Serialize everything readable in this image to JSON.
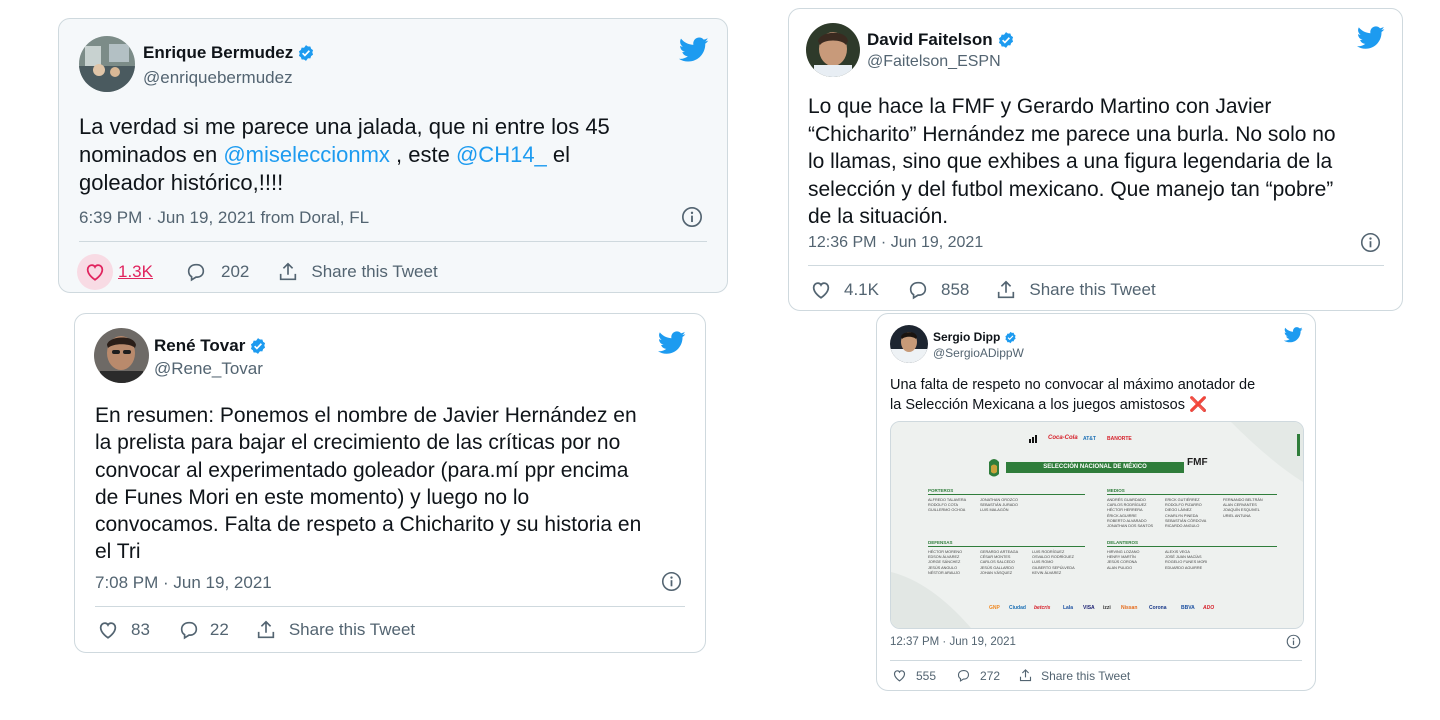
{
  "tweets": [
    {
      "name": "Enrique Bermudez",
      "handle": "@enriquebermudez",
      "body": [
        {
          "text": "La verdad si me parece una jalada, que ni entre los 45\nnominados en "
        },
        {
          "text": "@miseleccionmx",
          "mention": true
        },
        {
          "text": " , este "
        },
        {
          "text": "@CH14_",
          "mention": true
        },
        {
          "text": " el\ngoleador histórico,!!!!"
        }
      ],
      "time": "6:39 PM · Jun 19, 2021 from Doral, FL",
      "likes": "1.3K",
      "replies": "202",
      "share": "Share this Tweet"
    },
    {
      "name": "David Faitelson",
      "handle": "@Faitelson_ESPN",
      "body": [
        {
          "text": "Lo que hace la FMF y Gerardo Martino con Javier\n“Chicharito” Hernández me parece una burla. No solo no\nlo llamas, sino que exhibes a una figura legendaria de la\nselección y del futbol mexicano. Que manejo tan “pobre”\nde la situación."
        }
      ],
      "time": "12:36 PM · Jun 19, 2021",
      "likes": "4.1K",
      "replies": "858",
      "share": "Share this Tweet"
    },
    {
      "name": "René Tovar",
      "handle": "@Rene_Tovar",
      "body": [
        {
          "text": "En resumen: Ponemos el nombre de Javier Hernández en\nla prelista para bajar el crecimiento de las críticas por no\nconvocar al experimentado goleador (para.mí ppr encima\nde Funes Mori en este momento) y luego no lo\nconvocamos. Falta de respeto a Chicharito y su historia en\nel Tri"
        }
      ],
      "time": "7:08 PM · Jun 19, 2021",
      "likes": "83",
      "replies": "22",
      "share": "Share this Tweet"
    },
    {
      "name": "Sergio Dipp",
      "handle": "@SergioADippW",
      "body": [
        {
          "text": "Una falta de respeto no convocar al máximo anotador de\nla Selección Mexicana a los juegos amistosos ❌"
        }
      ],
      "time": "12:37 PM · Jun 19, 2021",
      "likes": "555",
      "replies": "272",
      "share": "Share this Tweet",
      "media": {
        "title": "SELECCIÓN NACIONAL DE MÉXICO",
        "logo": "FMF",
        "sections": {
          "porteros": {
            "label": "PORTEROS",
            "players": [
              "ALFREDO TALAVERA",
              "RODOLFO COTA",
              "GUILLERMO OCHOA",
              "JONATHAN OROZCO",
              "SEBASTIÁN JURADO",
              "LUIS MALAGÓN"
            ]
          },
          "medios": {
            "label": "MEDIOS",
            "players": [
              "ANDRÉS GUARDADO",
              "CARLOS RODRÍGUEZ",
              "HÉCTOR HERRERA",
              "ÉRICK AGUIRRE",
              "ROBERTO ALVARADO",
              "JONATHAN DOS SANTOS",
              "ERICK GUTIÉRREZ",
              "RODOLFO PIZARRO",
              "DIEGO LÁINEZ",
              "CHARLYN PINEDA",
              "SEBASTIÁN CÓRDOVA",
              "RICARDO ANGULO",
              "FERNANDO BELTRÁN",
              "ALAN CERVANTES",
              "JOAQUÍN ESQUIVEL",
              "URIEL ANTUNA"
            ]
          },
          "defensas": {
            "label": "DEFENSAS",
            "players": [
              "HÉCTOR MORENO",
              "EDSON ÁLVAREZ",
              "JORGE SÁNCHEZ",
              "JESÚS ANGULO",
              "NÉSTOR ARAUJO",
              "GERARDO ARTEAGA",
              "CÉSAR MONTES",
              "CARLOS SALCEDO",
              "JESÚS GALLARDO",
              "JOHAN VÁSQUEZ",
              "LUIS RODRÍGUEZ",
              "OSVALDO RODRÍGUEZ",
              "LUIS ROMO",
              "GILBERTO SEPÚLVEDA",
              "KEVIN ÁLVAREZ"
            ]
          },
          "delanteros": {
            "label": "DELANTEROS",
            "players": [
              "HIRVING LOZANO",
              "HENRY MARTÍN",
              "JESÚS CORONA",
              "ALAN PULIDO",
              "ALEXIS VEGA",
              "JOSÉ JUAN MACÍAS",
              "ROGELIO FUNES MORI",
              "EDUARDO AGUIRRE"
            ]
          }
        },
        "sponsors_top": [
          "adidas",
          "Coca-Cola",
          "AT&T",
          "BANORTE"
        ],
        "sponsors_bottom": [
          "GNP",
          "Ciudad",
          "betcris",
          "Lala",
          "VISA",
          "izzi",
          "Nissan",
          "Corona",
          "BBVA",
          "ADO"
        ]
      }
    }
  ],
  "colors": {
    "twitter_blue": "#1d9bf0",
    "like_pink": "#e0245e",
    "text_gray": "#536471",
    "roster_green": "#2f7d3b"
  },
  "icons": [
    "twitter-bird-icon",
    "verified-badge-icon",
    "heart-icon",
    "reply-icon",
    "share-icon",
    "info-icon",
    "cross-mark-emoji"
  ]
}
